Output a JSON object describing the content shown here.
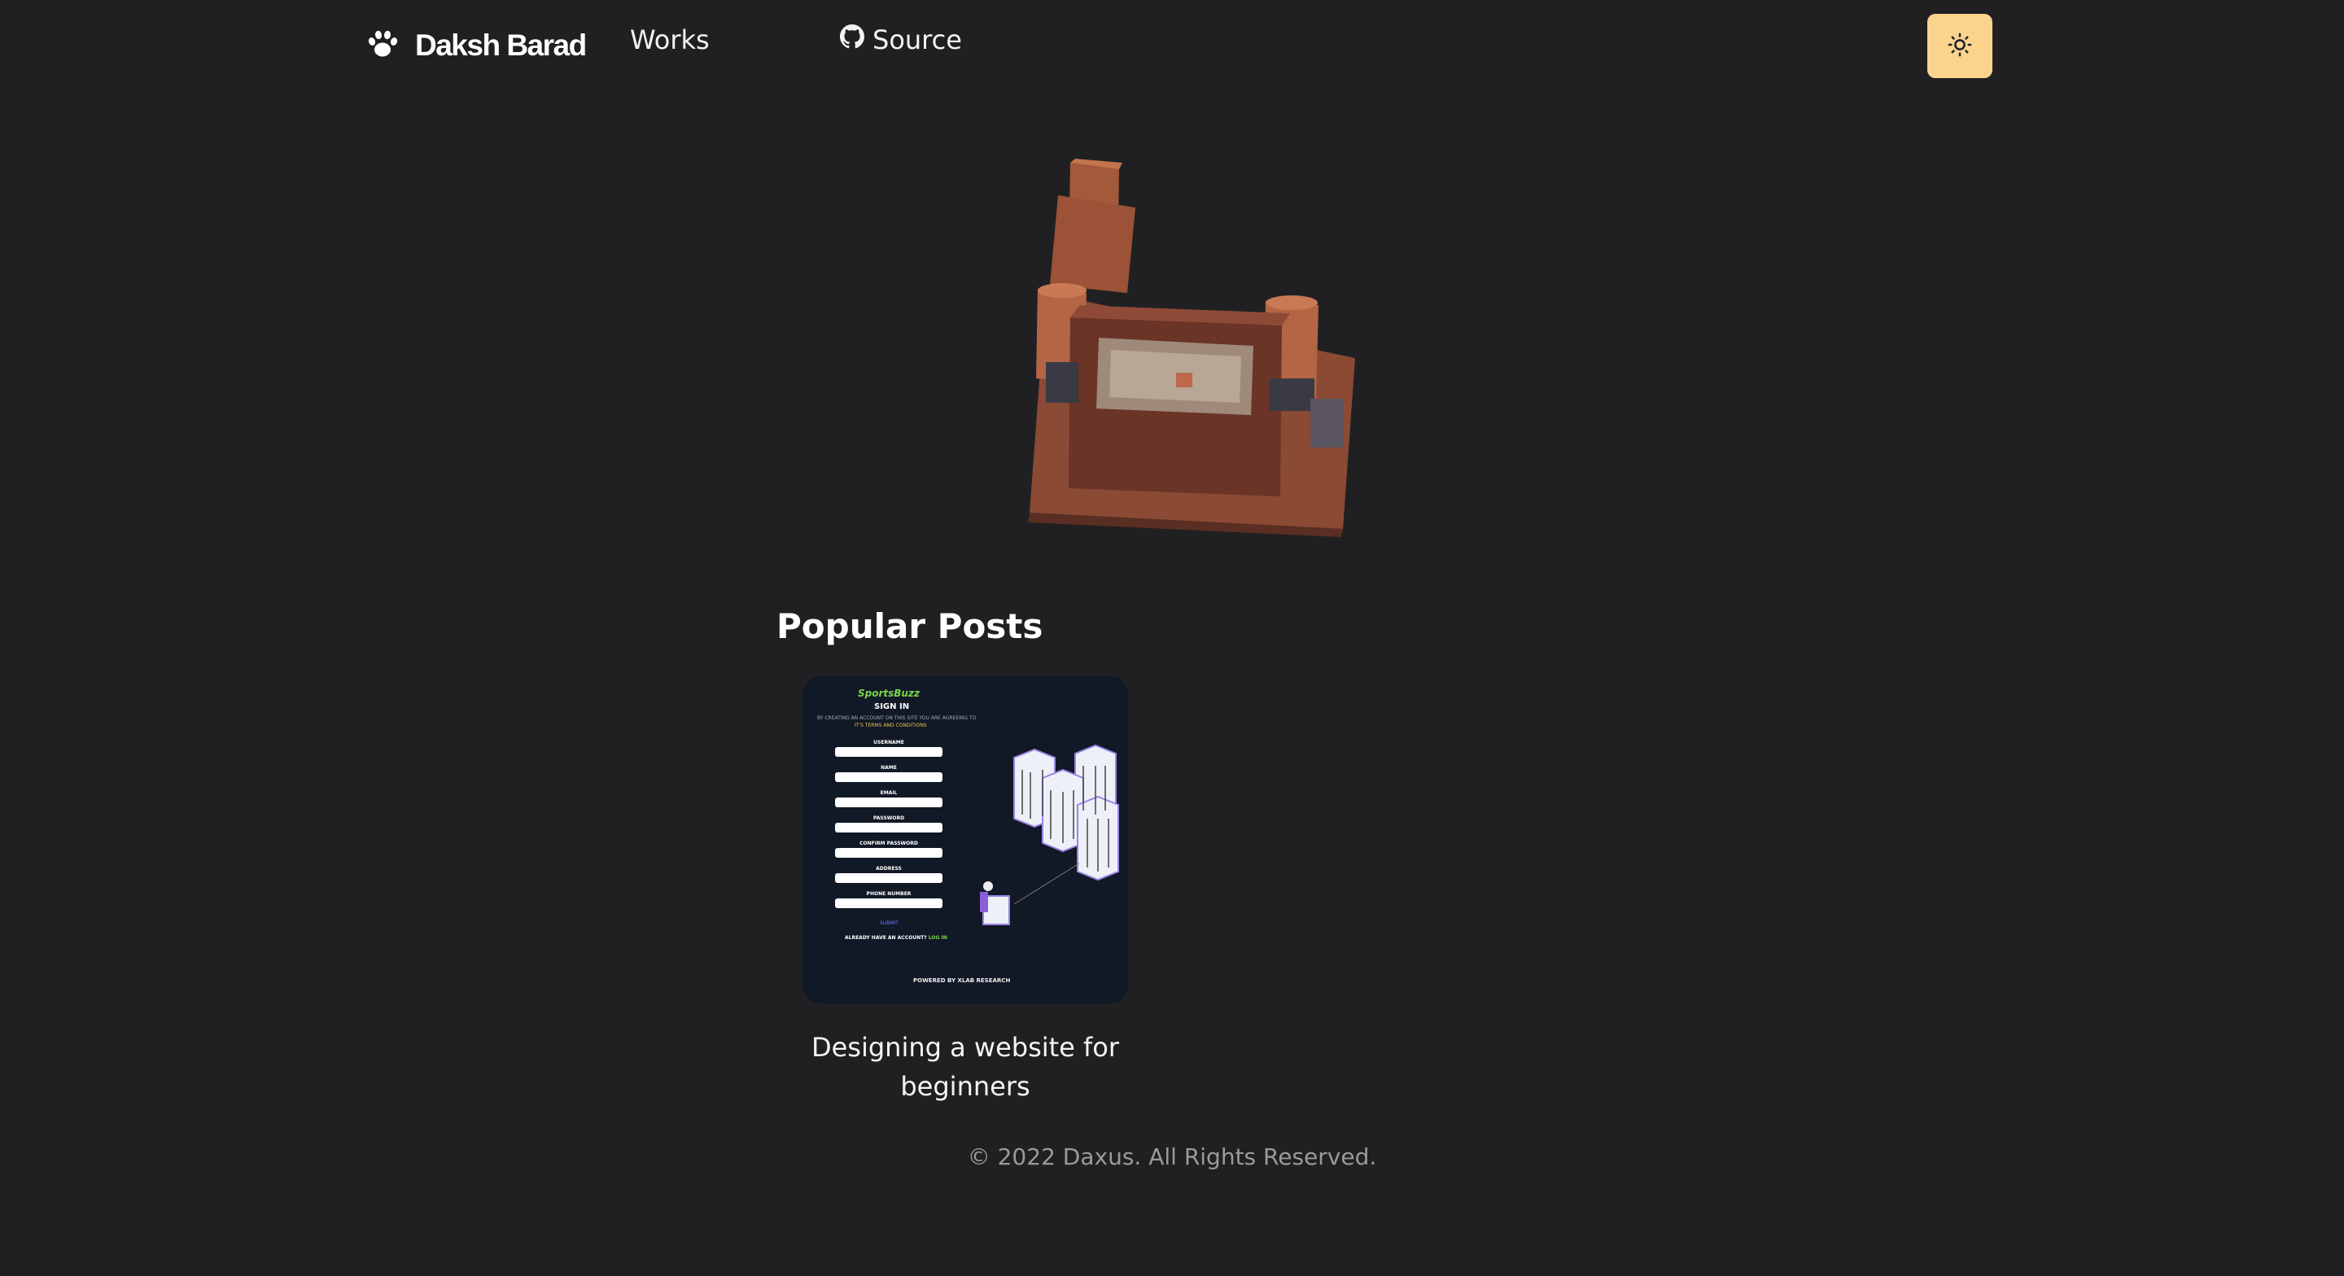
{
  "nav": {
    "brand": "Daksh Barad",
    "links": [
      {
        "label": "Works"
      },
      {
        "label": "Source"
      }
    ],
    "theme_button_color": "#fbd38d"
  },
  "hero": {
    "icon": "3d-voxel-room-illustration"
  },
  "popular": {
    "title": "Popular Posts",
    "posts": [
      {
        "title": "Designing a website for beginners",
        "thumbnail": {
          "brand": "SportsBuzz",
          "heading": "SIGN IN",
          "subtext": "BY CREATING AN ACCOUNT ON THIS SITE YOU ARE AGREEING TO",
          "terms": "IT'S TERMS AND CONDITIONS",
          "fields": [
            "USERNAME",
            "NAME",
            "EMAIL",
            "PASSWORD",
            "CONFIRM PASSWORD",
            "ADDRESS",
            "PHONE NUMBER"
          ],
          "submit": "SUBMIT",
          "already_prefix": "ALREADY HAVE AN ACCOUNT?",
          "already_link": "LOG IN",
          "powered": "POWERED BY XLAB RESEARCH"
        }
      }
    ]
  },
  "footer": {
    "text": "© 2022 Daxus. All Rights Reserved."
  },
  "colors": {
    "background": "#202023",
    "accent": "#fbd38d"
  }
}
